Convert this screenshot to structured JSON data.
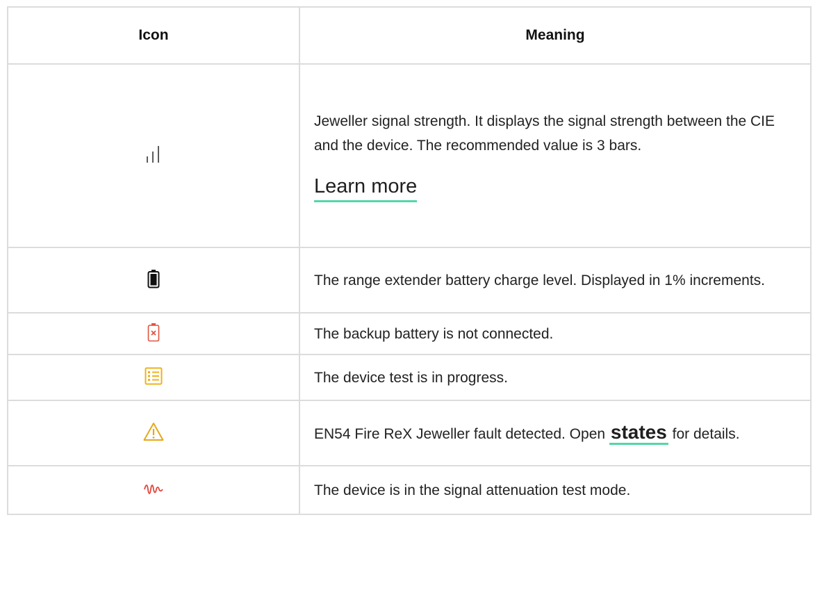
{
  "table": {
    "headers": [
      "Icon",
      "Meaning"
    ],
    "rows": [
      {
        "icon": "signal-strength-icon",
        "text": "Jeweller signal strength. It displays the signal strength between the CIE and the device. The recommended value is 3 bars.",
        "link": "Learn more"
      },
      {
        "icon": "battery-full-icon",
        "text": "The range extender battery charge level. Displayed in 1% increments."
      },
      {
        "icon": "battery-disconnected-icon",
        "text": "The backup battery is not connected."
      },
      {
        "icon": "device-test-icon",
        "text": "The device test is in progress."
      },
      {
        "icon": "warning-icon",
        "text_before": "EN54 Fire ReX Jeweller fault detected. Open ",
        "link": "states",
        "text_after": " for details."
      },
      {
        "icon": "signal-attenuation-icon",
        "text": "The device is in the signal attenuation test mode."
      }
    ]
  },
  "colors": {
    "border": "#dcdcdc",
    "link_underline": "#52d7a7",
    "battery_disconnected": "#e0533f",
    "device_test": "#f0b21b",
    "warning": "#e6a817",
    "attenuation": "#e2443a"
  }
}
